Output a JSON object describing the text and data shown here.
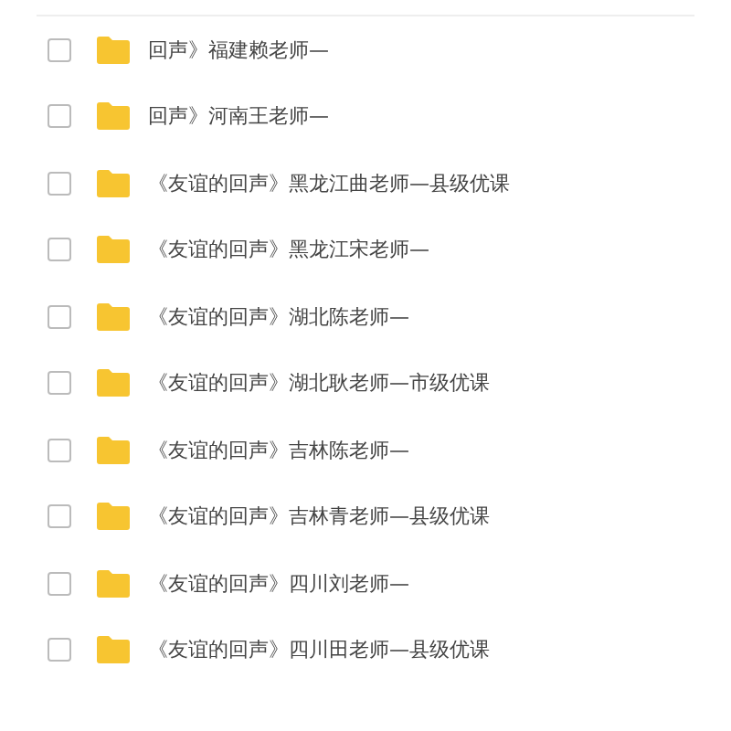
{
  "rows": [
    {
      "name": "回声》福建赖老师—",
      "checked": false
    },
    {
      "name": "回声》河南王老师—",
      "checked": false
    },
    {
      "name": "《友谊的回声》黑龙江曲老师—县级优课",
      "checked": false
    },
    {
      "name": "《友谊的回声》黑龙江宋老师—",
      "checked": false
    },
    {
      "name": "《友谊的回声》湖北陈老师—",
      "checked": false
    },
    {
      "name": "《友谊的回声》湖北耿老师—市级优课",
      "checked": false
    },
    {
      "name": "《友谊的回声》吉林陈老师—",
      "checked": false
    },
    {
      "name": "《友谊的回声》吉林青老师—县级优课",
      "checked": false
    },
    {
      "name": "《友谊的回声》四川刘老师—",
      "checked": false
    },
    {
      "name": "《友谊的回声》四川田老师—县级优课",
      "checked": false
    }
  ]
}
